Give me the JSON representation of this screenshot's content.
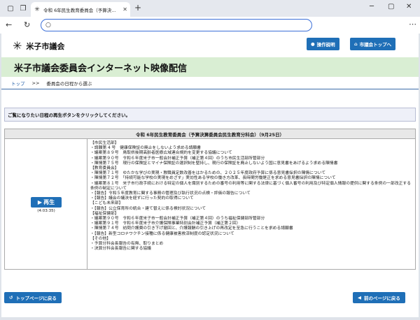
{
  "browser": {
    "tab_title": "令和 6年民生教育委員会（予算決…",
    "address": ""
  },
  "header": {
    "logo_text": "米子市議会",
    "btn_manual": "操作説明",
    "btn_top": "市議会トップへ"
  },
  "banner": {
    "title": "米子市議会委員会インターネット映像配信"
  },
  "breadcrumb": {
    "home": "トップ",
    "sep": ">>",
    "current": "委員会の日程から選ぶ"
  },
  "notice": "ご覧になりたい日程の再生ボタンをクリックしてください。",
  "meeting": {
    "title": "令和 6年民生教育委員会（予算決算委員会民生教育分科会）（9月25日）",
    "play_label": "再生",
    "duration": "(4:03:35)",
    "items": [
      "【市民生活部】",
      "・請願第 4 号　健康保険証の廃止をしないよう求める請願書",
      "・議案第８９号　鳥取県後期高齢者医療広域連合規約を変更する協議について",
      "・議案第９０号　令和６年度米子市一般会計補正予算（補正第４回）のうち市民生活部所管部分",
      "・陳情第７５号　現行の保険証とマイナ保険証の選択制を堅持し、現行の保険証を廃止しないよう国に意見書をあげるよう求める陳情書",
      "【教育委員会】",
      "・陳情第７１号　ゆたかな学びの実現・教職員定数改善をはかるための、２０２５年度政府予算に係る意見書採択の陳情について",
      "・陳情第７２号　「持続可能な学校の実現をめざす」実効性ある学校の働き方改革、長時間労働是正を求める意見書採択の陳情について",
      "・議案第８１号　米子市行政手続における特定の個人を識別するための番号の利用等に関する法律に基づく個人番号の利用及び特定個人情報の提供に関する条例の一部改正する条例の制定について",
      "・【報告】令和５年度教育に関する事務の管理及び執行状況の点検・評価の報告について",
      "・【報告】議会の議決を経ずに行った契約の取得について",
      "【こども未来部】",
      "・【報告】公立保育所の統合・建て替えに係る検討状況について",
      "【福祉保健部】",
      "・議案第９０号　令和６年度米子市一般会計補正予算（補正第４回）のうち福祉保健部所管部分",
      "・議案第９１号　令和６年度米子市介護保険事業特別会計補正予算（補正第２回）",
      "・陳情第７４号　訪問介護費の引き下げ撤回と、介護報酬の引き上げの再改定を至急に行うことを求める請願書",
      "・【報告】新型コロナワクチン接種に係る健康被害救済制度の認定状況について",
      "【その他】",
      "・予算分科会長報告の有無、取りまとめ",
      "・決算分科会長報告に関する協議"
    ]
  },
  "footer": {
    "btn_toppage": "トップページに戻る",
    "btn_back": "前のページに戻る"
  }
}
